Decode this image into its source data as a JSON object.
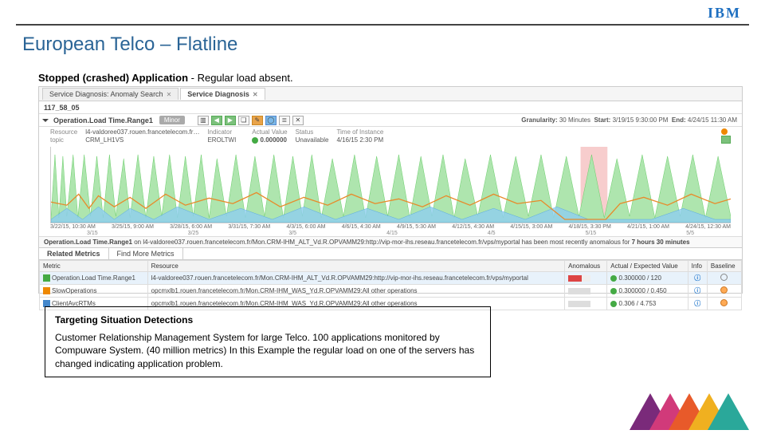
{
  "brand": {
    "logo_text": "IBM"
  },
  "page": {
    "title": "European Telco – Flatline",
    "subtitle_bold": "Stopped (crashed) Application",
    "subtitle_rest": " - Regular load absent."
  },
  "screenshot": {
    "tab1": "Service Diagnosis: Anomaly Search",
    "tab2": "Service Diagnosis",
    "breadcrumb": "117_58_05",
    "metric_header": "Operation.Load Time.Range1",
    "severity": "Minor",
    "granularity_label": "Granularity:",
    "granularity_value": "30 Minutes",
    "start_label": "Start:",
    "start_value": "3/19/15 9:30:00 PM",
    "end_label": "End:",
    "end_value": "4/24/15 11:30 AM",
    "meta": {
      "r1l": "Resource",
      "r1v": "l4-valdoree037.rouen.francetelecom.fr…",
      "r2l": "topic",
      "r2v": "CRM_LH1VS",
      "r3l": "Indicator",
      "r3v": "EROLTWI",
      "av_l": "Actual Value",
      "av_v": "0.000000",
      "st_l": "Status",
      "st_v": "Unavailable",
      "ti_l": "Time of Instance",
      "ti_v": "4/16/15 2:30 PM"
    },
    "xaxis": [
      "3/22/15, 10:30 AM",
      "3/25/15, 9:00 AM",
      "3/28/15, 6:00 AM",
      "3/31/15, 7:30 AM",
      "4/3/15, 6:00 AM",
      "4/6/15, 4:30 AM",
      "4/9/15, 5:30 AM",
      "4/12/15, 4:30 AM",
      "4/15/15, 3:00 AM",
      "4/18/15, 3:30 PM",
      "4/21/15, 1:00 AM",
      "4/24/15, 12:30 AM"
    ],
    "xaxis_weeks": [
      "3/15",
      "3/25",
      "3/5",
      "4/15",
      "4/5",
      "5/15",
      "5/5"
    ],
    "anomaly_text_a": "Operation.Load Time.Range1",
    "anomaly_text_b": " on l4-valdoree037.rouen.francetelecom.fr/Mon.CRM-IHM_ALT_Vd.R.OPVAMM29:http://vip-mor-ihs.reseau.francetelecom.fr/vps/myportal has been most recently anomalous for ",
    "anomaly_text_c": "7 hours 30 minutes",
    "related_tabs": {
      "t1": "Related Metrics",
      "t2": "Find More Metrics"
    },
    "table": {
      "headers": [
        "Metric",
        "Resource",
        "Anomalous",
        "Actual / Expected Value",
        "Info",
        "Baseline"
      ],
      "rows": [
        {
          "metric": "Operation.Load Time.Range1",
          "rsrc": "l4-valdoree037.rouen.francetelecom.fr/Mon.CRM-IHM_ALT_Vd.R.OPVAMM29:http://vip-mor-ihs.reseau.francetelecom.fr/vps/myportal",
          "val": "0.300000 / 120",
          "hl": true,
          "sqc": "green"
        },
        {
          "metric": "SlowOperations",
          "rsrc": "opcmxlb1.rouen.francetelecom.fr/Mon.CRM-IHM_WAS_Yd.R.OPVAMM29:All other operations",
          "val": "0.300000 / 0.450",
          "sqc": "org"
        },
        {
          "metric": "ClientAvcRTMs",
          "rsrc": "opcmxlb1.rouen.francetelecom.fr/Mon.CRM-IHM_WAS_Yd.R.OPVAMM29:All other operations",
          "val": "0.306 / 4.753",
          "sqc": "blue"
        }
      ]
    }
  },
  "note": {
    "heading": "Targeting Situation Detections",
    "body": "Customer Relationship Management System for large Telco. 100 applications monitored by Compuware System. (40 million metrics) In this Example the regular load on one of the servers has changed indicating application problem."
  },
  "chart_data": {
    "type": "line",
    "note": "Approximate time series of server load showing daily periodic pattern with flatline anomaly around 4/15–4/18",
    "green_pattern": "periodic daily area peaking near 1.0, ~11 visible cycles",
    "orange_series": "actual value, roughly 0.2–0.5 with noise, drops to 0 during anomaly window",
    "anomaly_band": {
      "start_frac": 0.78,
      "end_frac": 0.82
    },
    "ylim": [
      0,
      1.2
    ]
  }
}
